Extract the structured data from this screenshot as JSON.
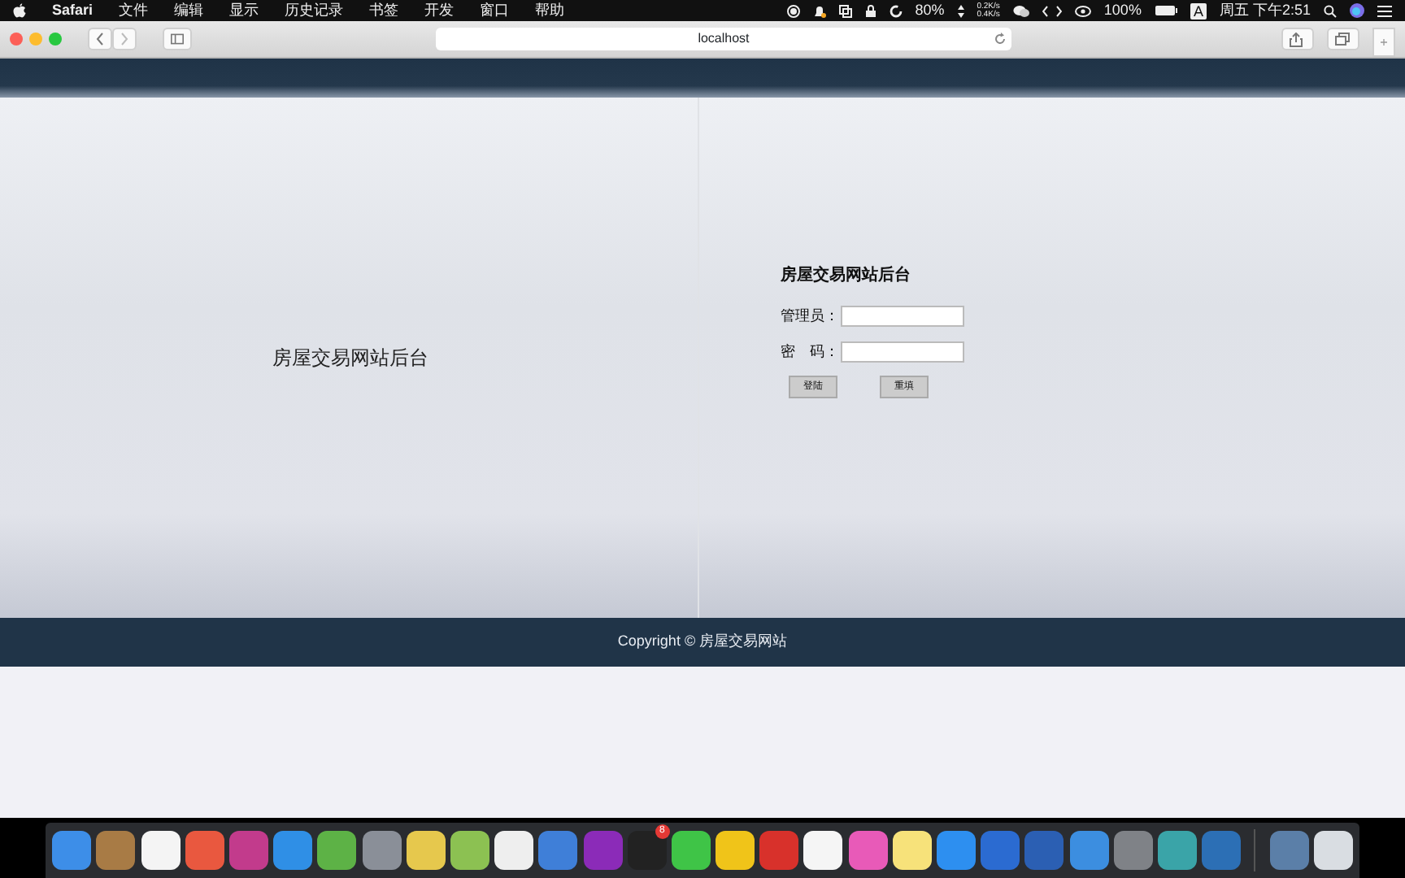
{
  "menu_bar": {
    "app": "Safari",
    "menus": [
      "文件",
      "编辑",
      "显示",
      "历史记录",
      "书签",
      "开发",
      "窗口",
      "帮助"
    ],
    "battery_small": "80%",
    "net_up": "0.2K/s",
    "net_down": "0.4K/s",
    "battery": "100%",
    "input_method": "A",
    "clock": "周五 下午2:51"
  },
  "browser": {
    "address": "localhost"
  },
  "page": {
    "side_title": "房屋交易网站后台",
    "form": {
      "title": "房屋交易网站后台",
      "fields": [
        {
          "label": "管理员："
        },
        {
          "label": "密　码："
        }
      ],
      "buttons": [
        "登陆",
        "重填"
      ]
    },
    "footer": "Copyright © 房屋交易网站"
  },
  "dock": [
    {
      "color": "#3d8ee8"
    },
    {
      "color": "#a87b45"
    },
    {
      "color": "#f4f4f4"
    },
    {
      "color": "#e9583f"
    },
    {
      "color": "#c23b8c"
    },
    {
      "color": "#2f8fe6"
    },
    {
      "color": "#5db246"
    },
    {
      "color": "#8a8f98"
    },
    {
      "color": "#e6c84d"
    },
    {
      "color": "#8cc152"
    },
    {
      "color": "#eeeeee"
    },
    {
      "color": "#3f7fd8"
    },
    {
      "color": "#8b2bb8"
    },
    {
      "color": "#222222",
      "badge": "8"
    },
    {
      "color": "#3fc447"
    },
    {
      "color": "#f0c419"
    },
    {
      "color": "#d8312b"
    },
    {
      "color": "#f5f5f5"
    },
    {
      "color": "#e85ab8"
    },
    {
      "color": "#f7e27a"
    },
    {
      "color": "#2d8ff0"
    },
    {
      "color": "#2b6bd1"
    },
    {
      "color": "#2b5fb3"
    },
    {
      "color": "#3c8ee0"
    },
    {
      "color": "#7f8287"
    },
    {
      "color": "#3aa4a8"
    },
    {
      "color": "#2c6fb5"
    },
    {
      "color": "#5b7fa8",
      "separator_before": true
    },
    {
      "color": "#d9dde2"
    }
  ]
}
